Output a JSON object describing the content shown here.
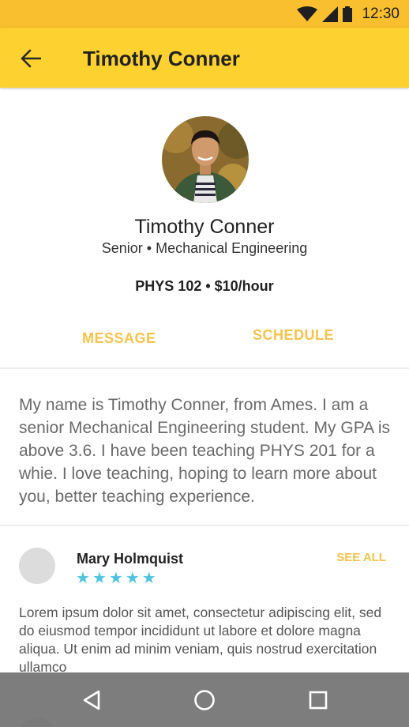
{
  "status_bar": {
    "time": "12:30",
    "icons": [
      "wifi-icon",
      "cell-signal-icon",
      "battery-icon"
    ]
  },
  "app_bar": {
    "title": "Timothy Conner",
    "back_icon": "arrow-back-icon"
  },
  "profile": {
    "name": "Timothy Conner",
    "subtitle": "Senior • Mechanical Engineering",
    "course_rate": "PHYS 102 • $10/hour",
    "actions": {
      "message_label": "MESSAGE",
      "schedule_label": "SCHEDULE"
    }
  },
  "bio": "My name is Timothy Conner, from Ames. I am a senior Mechanical Engineering student. My GPA is above 3.6. I have been teaching PHYS 201 for a whie. I love teaching, hoping to learn more about you, better teaching experience.",
  "reviews": {
    "see_all_label": "SEE ALL",
    "items": [
      {
        "name": "Mary Holmquist",
        "rating": 5,
        "text": "Lorem ipsum dolor sit amet, consectetur adipiscing elit, sed do eiusmod tempor incididunt ut labore et dolore magna aliqua. Ut enim ad minim veniam, quis nostrud exercitation ullamco"
      }
    ]
  },
  "nav_bar": {
    "icons": [
      "nav-back-icon",
      "nav-home-icon",
      "nav-recents-icon"
    ]
  },
  "colors": {
    "status_bar": "#f9bf2e",
    "app_bar": "#fdd12f",
    "accent": "#f7c34a",
    "stars": "#4fc3e0"
  }
}
